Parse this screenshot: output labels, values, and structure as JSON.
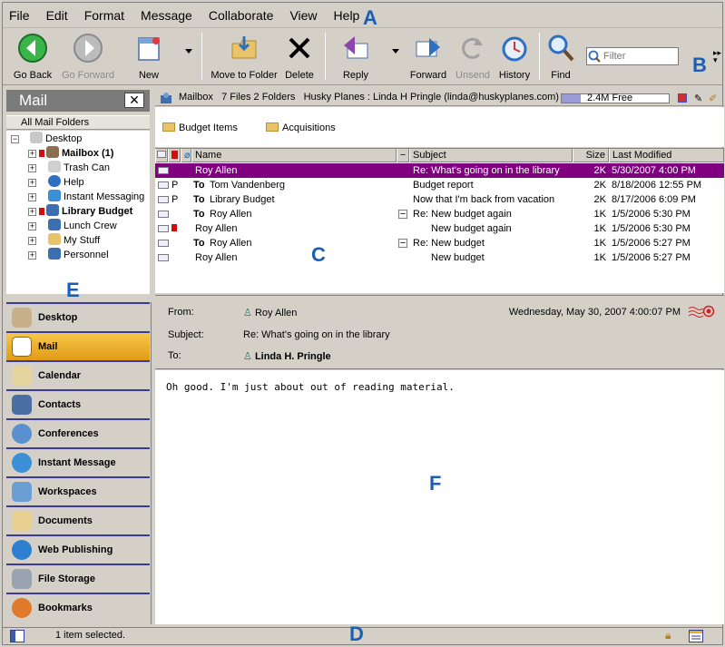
{
  "callouts": {
    "a": "A",
    "b": "B",
    "c": "C",
    "d": "D",
    "e": "E",
    "f": "F"
  },
  "menu": [
    "File",
    "Edit",
    "Format",
    "Message",
    "Collaborate",
    "View",
    "Help"
  ],
  "toolbar": {
    "go_back": "Go Back",
    "go_forward": "Go Forward",
    "new": "New",
    "move_to_folder": "Move to Folder",
    "delete": "Delete",
    "reply": "Reply",
    "forward": "Forward",
    "unsend": "Unsend",
    "history": "History",
    "find": "Find",
    "filter_placeholder": "Filter"
  },
  "left_pane": {
    "title": "Mail",
    "all_folders": "All Mail Folders",
    "tree": [
      {
        "label": "Desktop",
        "bold": false
      },
      {
        "label": "Mailbox (1)",
        "bold": true
      },
      {
        "label": "Trash Can",
        "bold": false
      },
      {
        "label": "Help",
        "bold": false
      },
      {
        "label": "Instant Messaging",
        "bold": false
      },
      {
        "label": "Library Budget",
        "bold": true
      },
      {
        "label": "Lunch Crew",
        "bold": false
      },
      {
        "label": "My Stuff",
        "bold": false
      },
      {
        "label": "Personnel",
        "bold": false
      }
    ]
  },
  "nav": [
    "Desktop",
    "Mail",
    "Calendar",
    "Contacts",
    "Conferences",
    "Instant Message",
    "Workspaces",
    "Documents",
    "Web Publishing",
    "File Storage",
    "Bookmarks"
  ],
  "mailbox_header": {
    "name": "Mailbox",
    "counts": "7 Files  2 Folders",
    "account": "Husky Planes : Linda H Pringle (linda@huskyplanes.com)",
    "free": "2.4M Free",
    "free_fraction": 0.18
  },
  "folders": [
    "Budget Items",
    "Acquisitions"
  ],
  "columns": {
    "name": "Name",
    "subject": "Subject",
    "size": "Size",
    "modified": "Last Modified"
  },
  "messages": [
    {
      "name": "Roy Allen",
      "prefix": "",
      "subject": "Re: What's going on in the library",
      "size": "2K",
      "modified": "5/30/2007  4:00 PM"
    },
    {
      "name": "Tom Vandenberg",
      "prefix": "To",
      "subject": "Budget report",
      "size": "2K",
      "modified": "8/18/2006  12:55 PM"
    },
    {
      "name": "Library Budget",
      "prefix": "To",
      "subject": "Now that I'm back from vacation",
      "size": "2K",
      "modified": "8/17/2006  6:09 PM"
    },
    {
      "name": "Roy Allen",
      "prefix": "To",
      "subject": "Re: New budget again",
      "size": "1K",
      "modified": "1/5/2006  5:30 PM"
    },
    {
      "name": "Roy Allen",
      "prefix": "",
      "subject": "New budget again",
      "size": "1K",
      "modified": "1/5/2006  5:30 PM"
    },
    {
      "name": "Roy Allen",
      "prefix": "To",
      "subject": "Re: New budget",
      "size": "1K",
      "modified": "1/5/2006  5:27 PM"
    },
    {
      "name": "Roy Allen",
      "prefix": "",
      "subject": "New budget",
      "size": "1K",
      "modified": "1/5/2006  5:27 PM"
    }
  ],
  "preview": {
    "from_label": "From:",
    "from": "Roy Allen",
    "date": "Wednesday, May 30, 2007 4:00:07 PM",
    "subject_label": "Subject:",
    "subject": "Re: What's going on in the library",
    "to_label": "To:",
    "to": "Linda H. Pringle",
    "body": "Oh good. I'm just about out of reading material."
  },
  "status": {
    "text": "1 item selected."
  },
  "colors": {
    "selection": "#800080",
    "active_nav": "#f0b030",
    "callout": "#1a5fb4"
  }
}
